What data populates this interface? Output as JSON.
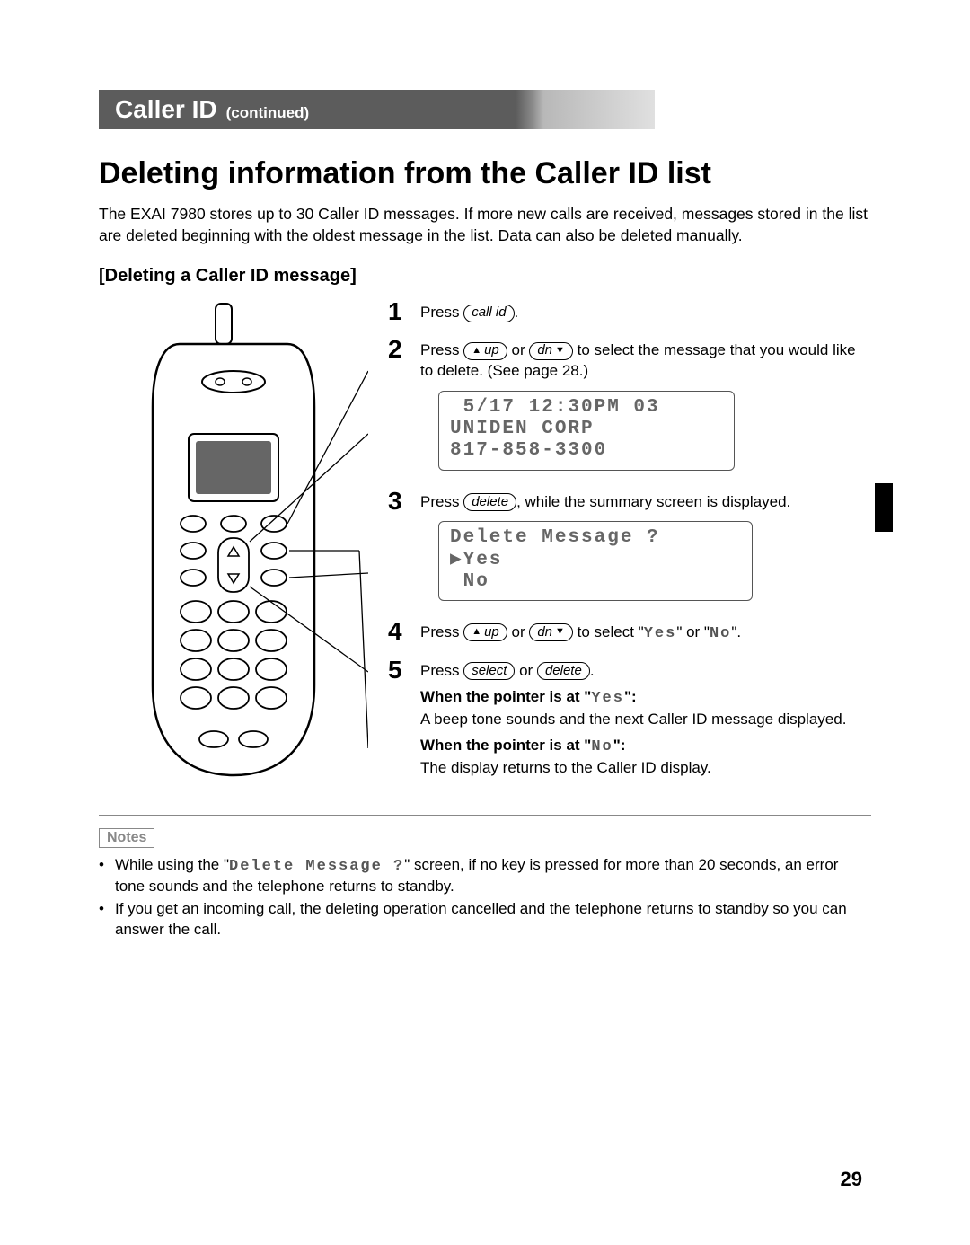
{
  "section": {
    "title": "Caller ID",
    "sub": "(continued)"
  },
  "heading": "Deleting information from the Caller ID list",
  "intro": "The EXAI 7980 stores up to 30 Caller ID messages. If more new calls are received, messages stored in the list are deleted beginning with the oldest message in the list. Data can also be deleted manually.",
  "subheading": "[Deleting a Caller ID message]",
  "keys": {
    "call_id": "call id",
    "up": "up",
    "dn": "dn",
    "delete": "delete",
    "select": "select"
  },
  "steps": {
    "s1": {
      "num": "1",
      "t1": "Press ",
      "t2": "."
    },
    "s2": {
      "num": "2",
      "t1": "Press ",
      "t2": " or ",
      "t3": " to select the message that you would like to delete. (See page 28.)",
      "lcd": {
        "l1": " 5/17 12:30PM 03",
        "l2": "UNIDEN CORP",
        "l3": "817-858-3300"
      }
    },
    "s3": {
      "num": "3",
      "t1": "Press ",
      "t2": ", while the summary screen is displayed.",
      "lcd": {
        "l1": "Delete Message ?",
        "l2": "▶Yes",
        "l3": " No"
      }
    },
    "s4": {
      "num": "4",
      "t1": "Press ",
      "t2": " or ",
      "t3": " to select \"",
      "yes": "Yes",
      "t4": "\" or \"",
      "no": "No",
      "t5": "\"."
    },
    "s5": {
      "num": "5",
      "t1": "Press ",
      "t2": " or ",
      "t3": ".",
      "r1_lead": "When the pointer is at \"",
      "r1_val": "Yes",
      "r1_tail": "\":",
      "r1_body": "A beep tone sounds and the next Caller ID message displayed.",
      "r2_lead": "When the pointer is at \"",
      "r2_val": "No",
      "r2_tail": "\":",
      "r2_body": "The display returns to the Caller ID display."
    }
  },
  "notes": {
    "label": "Notes",
    "i1a": "While using the \"",
    "i1m": "Delete Message ?",
    "i1b": "\" screen, if no key is pressed for more than 20 seconds, an error tone sounds and the telephone returns to standby.",
    "i2": "If you get an incoming call, the deleting operation cancelled and the telephone returns to standby so you can answer the call."
  },
  "page_number": "29"
}
